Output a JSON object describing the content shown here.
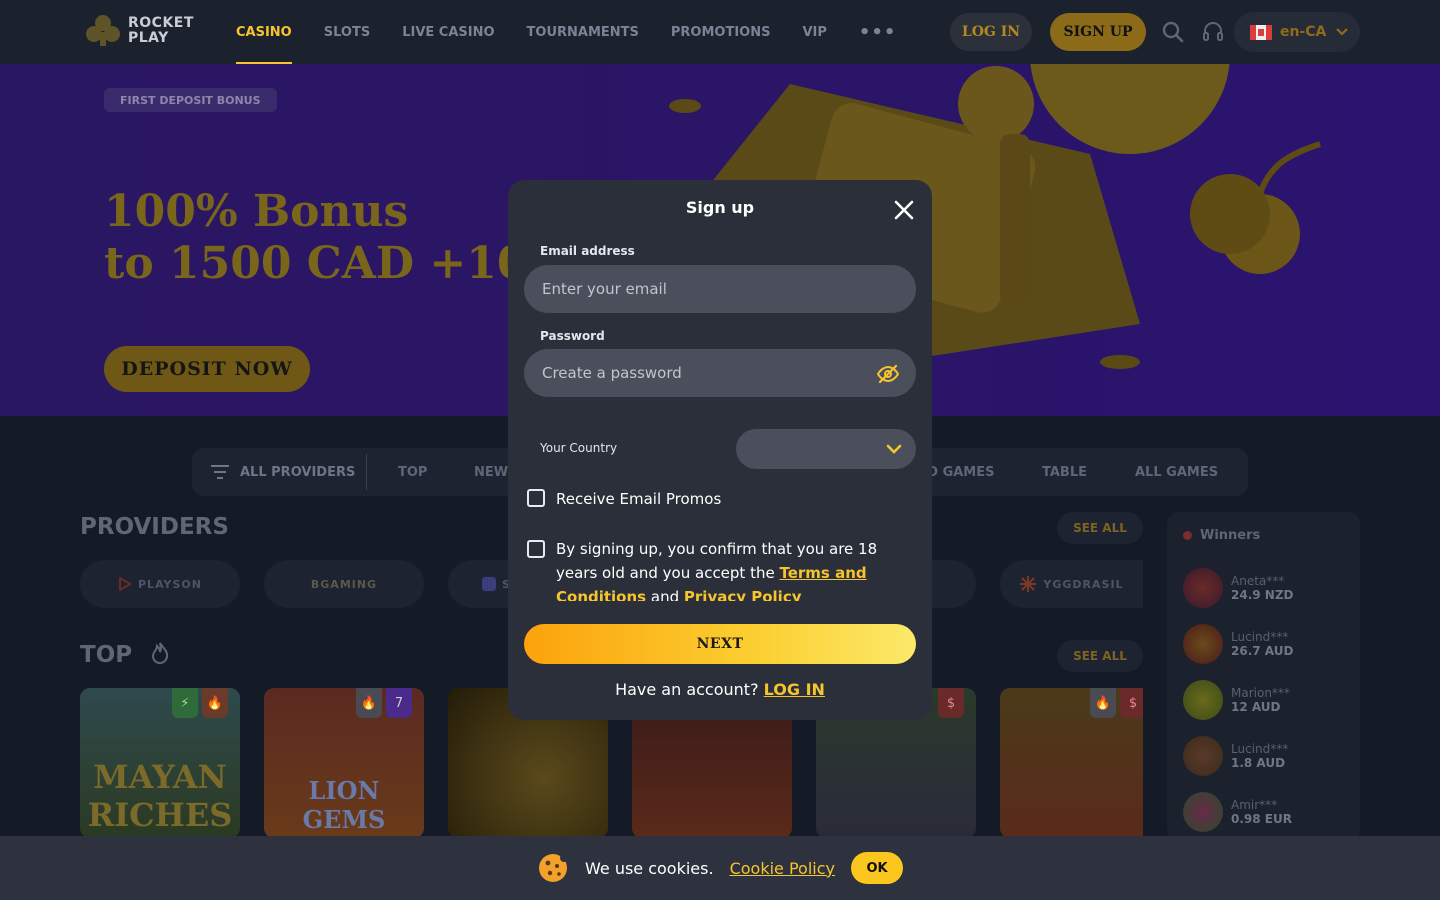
{
  "header": {
    "logo_line1": "ROCKET",
    "logo_line2": "PLAY",
    "nav": [
      {
        "label": "CASINO",
        "active": true
      },
      {
        "label": "SLOTS"
      },
      {
        "label": "LIVE CASINO"
      },
      {
        "label": "TOURNAMENTS"
      },
      {
        "label": "PROMOTIONS"
      },
      {
        "label": "VIP"
      }
    ],
    "more": "•••",
    "login_label": "LOG IN",
    "signup_label": "SIGN UP",
    "language": "en-CA"
  },
  "hero": {
    "badge": "FIRST DEPOSIT BONUS",
    "title_line1": "100% Bonus",
    "title_line2": "to 1500 CAD +10",
    "cta": "DEPOSIT NOW"
  },
  "filters": {
    "all_providers": "ALL PROVIDERS",
    "items": [
      "TOP",
      "NEW",
      "O GAMES",
      "TABLE",
      "ALL GAMES"
    ]
  },
  "providers": {
    "title": "PROVIDERS",
    "see_all": "SEE ALL",
    "items": [
      "PLAYSON",
      "BGAMING",
      "S",
      "YGGDRASIL"
    ]
  },
  "top": {
    "title": "TOP",
    "see_all": "SEE ALL",
    "games": [
      "MAYAN RICHES",
      "LION GEMS",
      "",
      "",
      "",
      ""
    ]
  },
  "winners": {
    "title": "Winners",
    "items": [
      {
        "name": "Aneta***",
        "amount": "24.9 NZD"
      },
      {
        "name": "Lucind***",
        "amount": "26.7 AUD"
      },
      {
        "name": "Marion***",
        "amount": "12 AUD"
      },
      {
        "name": "Lucind***",
        "amount": "1.8 AUD"
      },
      {
        "name": "Amir***",
        "amount": "0.98 EUR"
      }
    ]
  },
  "modal": {
    "title": "Sign up",
    "email_label": "Email address",
    "email_placeholder": "Enter your email",
    "email_value": "",
    "password_label": "Password",
    "password_placeholder": "Create a password",
    "password_value": "",
    "country_label": "Your Country",
    "country_value": "",
    "promos_label": "Receive Email Promos",
    "terms_text": "By signing up, you confirm that you are 18 years old and you accept the",
    "terms_link": "Terms and Conditions",
    "terms_and": "and",
    "privacy_link": "Privacy Policy",
    "next_label": "NEXT",
    "have_account": "Have an account?",
    "login_link": "LOG IN"
  },
  "cookie": {
    "text": "We use cookies.",
    "link": "Cookie Policy",
    "ok": "OK"
  },
  "colors": {
    "accent": "#f6c52e",
    "modal_bg": "#2a2f3a",
    "field_bg": "#4a4f5b",
    "page_bg": "#141a26"
  }
}
